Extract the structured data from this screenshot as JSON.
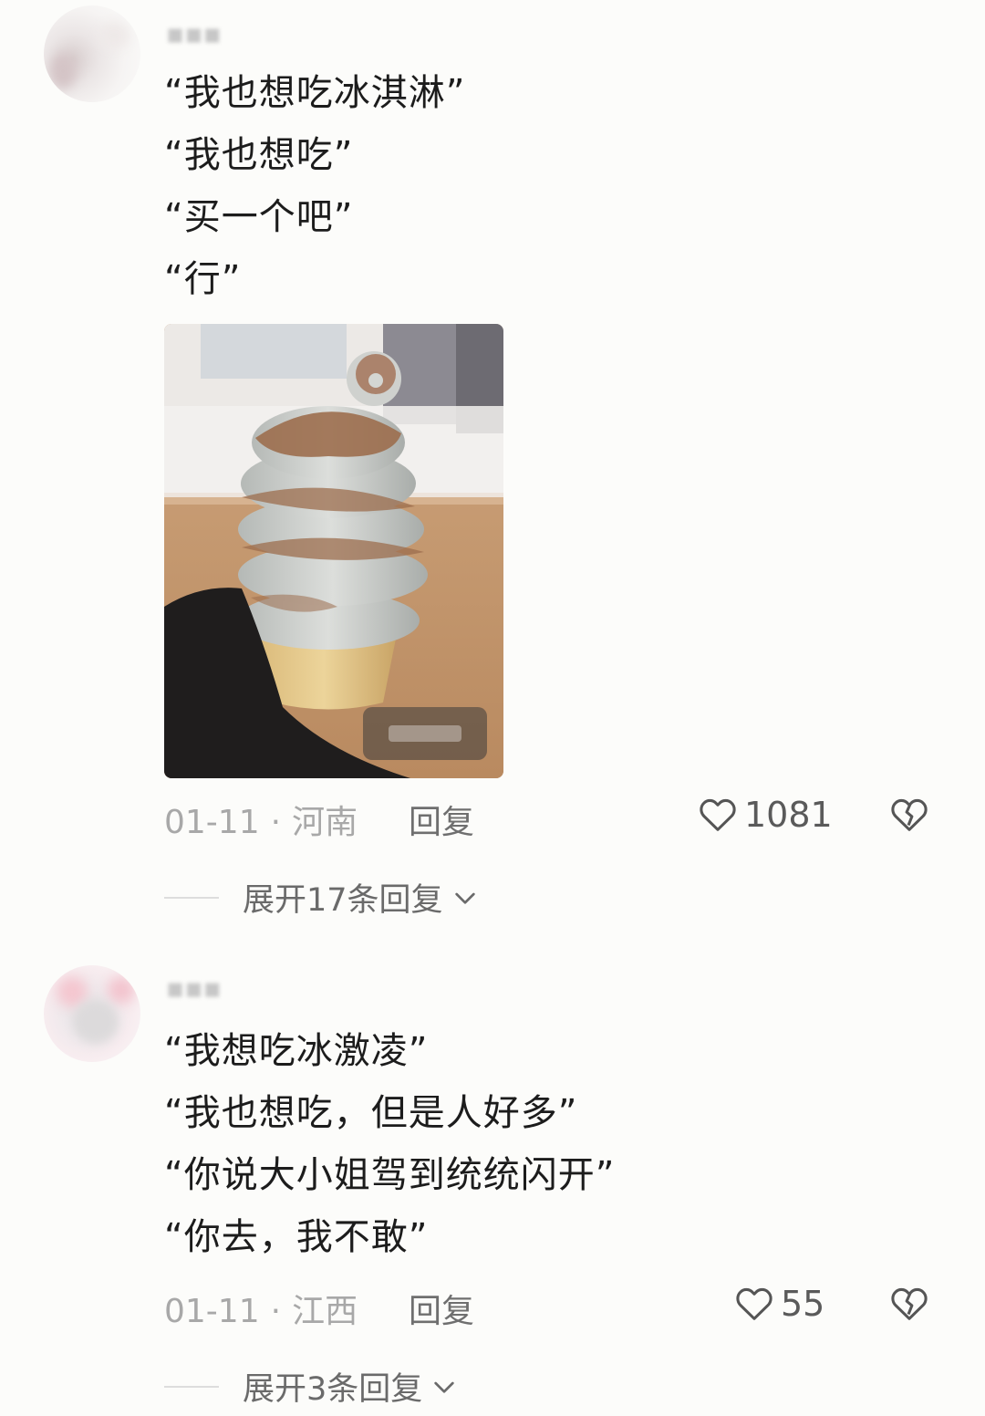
{
  "comments": [
    {
      "lines": [
        "“我也想吃冰淇淋”",
        "“我也想吃”",
        "“买一个吧”",
        "“行”"
      ],
      "date": "01-11",
      "separator": "·",
      "location": "河南",
      "reply_label": "回复",
      "likes": "1081",
      "expand_label": "展开17条回复"
    },
    {
      "lines": [
        "“我想吃冰激凌”",
        "“我也想吃，但是人好多”",
        "“你说大小姐驾到统统闪开”",
        "“你去，我不敢”"
      ],
      "date": "01-11",
      "separator": "·",
      "location": "江西",
      "reply_label": "回复",
      "likes": "55",
      "expand_label": "展开3条回复"
    }
  ],
  "icons": {
    "like": "heart-outline-icon",
    "dislike": "broken-heart-icon",
    "expand": "chevron-down-icon"
  },
  "colors": {
    "background": "#fcfcfa",
    "text": "#1c1c1c",
    "meta": "#a8a8a8",
    "secondary": "#6a6a6a"
  }
}
